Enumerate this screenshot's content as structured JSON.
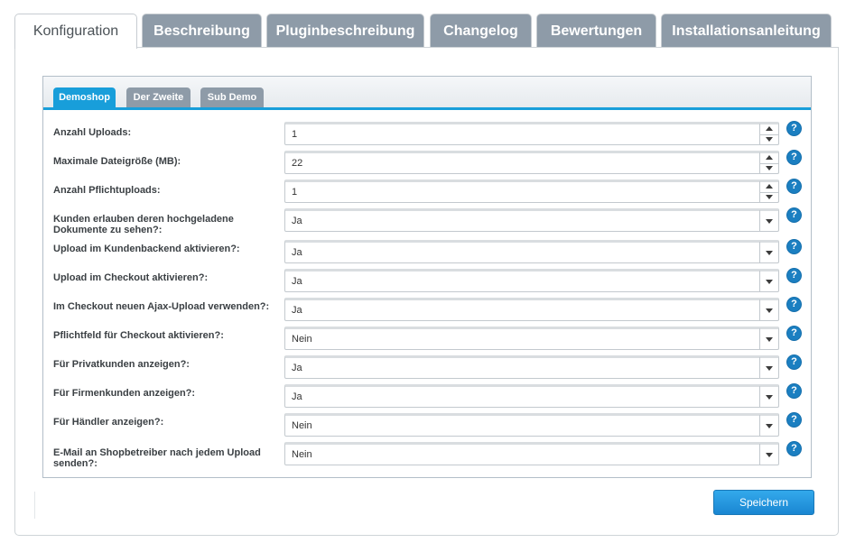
{
  "top_tabs": [
    {
      "label": "Konfiguration",
      "active": true
    },
    {
      "label": "Beschreibung"
    },
    {
      "label": "Pluginbeschreibung"
    },
    {
      "label": "Changelog"
    },
    {
      "label": "Bewertungen"
    },
    {
      "label": "Installationsanleitung"
    }
  ],
  "sub_tabs": [
    {
      "label": "Demoshop",
      "active": true
    },
    {
      "label": "Der Zweite"
    },
    {
      "label": "Sub Demo"
    }
  ],
  "fields": [
    {
      "label": "Anzahl Uploads:",
      "value": "1",
      "type": "number"
    },
    {
      "label": "Maximale Dateigröße (MB):",
      "value": "22",
      "type": "number"
    },
    {
      "label": "Anzahl Pflichtuploads:",
      "value": "1",
      "type": "number"
    },
    {
      "label": "Kunden erlauben deren hochgeladene Dokumente zu sehen?:",
      "value": "Ja",
      "type": "select"
    },
    {
      "label": "Upload im Kundenbackend aktivieren?:",
      "value": "Ja",
      "type": "select"
    },
    {
      "label": "Upload im Checkout aktivieren?:",
      "value": "Ja",
      "type": "select"
    },
    {
      "label": "Im Checkout neuen Ajax-Upload verwenden?:",
      "value": "Ja",
      "type": "select"
    },
    {
      "label": "Pflichtfeld für Checkout aktivieren?:",
      "value": "Nein",
      "type": "select"
    },
    {
      "label": "Für Privatkunden anzeigen?:",
      "value": "Ja",
      "type": "select"
    },
    {
      "label": "Für Firmenkunden anzeigen?:",
      "value": "Ja",
      "type": "select"
    },
    {
      "label": "Für Händler anzeigen?:",
      "value": "Nein",
      "type": "select"
    },
    {
      "label": "E-Mail an Shopbetreiber nach jedem Upload senden?:",
      "value": "Nein",
      "type": "select"
    }
  ],
  "help_glyph": "?",
  "save_label": "Speichern",
  "colors": {
    "accent": "#189eda",
    "tab_inactive": "#8e9ba8",
    "help": "#1b7fc1"
  }
}
